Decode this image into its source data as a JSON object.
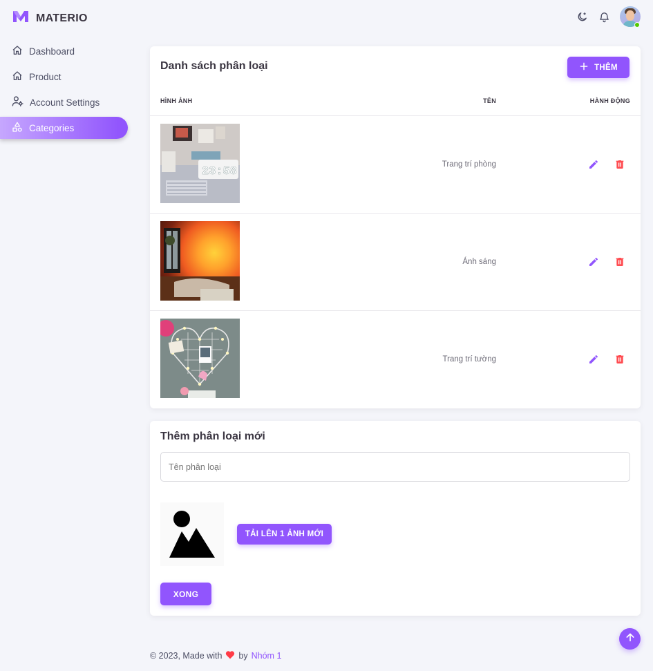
{
  "app": {
    "name": "MATERIO"
  },
  "nav": {
    "items": [
      {
        "label": "Dashboard",
        "icon": "home-icon"
      },
      {
        "label": "Product",
        "icon": "home-icon"
      },
      {
        "label": "Account Settings",
        "icon": "account-cog-icon"
      },
      {
        "label": "Categories",
        "icon": "shapes-icon",
        "active": true
      }
    ]
  },
  "list": {
    "title": "Danh sách phân loại",
    "add_label": "THÊM",
    "columns": {
      "image": "HÌNH ẢNH",
      "name": "TÊN",
      "actions": "HÀNH ĐỘNG"
    },
    "rows": [
      {
        "name": "Trang trí phòng",
        "image": "desk-clock-photo"
      },
      {
        "name": "Ánh sáng",
        "image": "sunset-lamp-photo"
      },
      {
        "name": "Trang trí tường",
        "image": "heart-wall-grid-photo"
      }
    ]
  },
  "form": {
    "title": "Thêm phân loại mới",
    "name_placeholder": "Tên phân loại",
    "upload_label": "TẢI LÊN 1 ẢNH MỚI",
    "done_label": "XONG"
  },
  "footer": {
    "prefix": "© 2023, Made with",
    "by": "by",
    "author": "Nhóm 1"
  },
  "colors": {
    "primary": "#9155fd",
    "danger": "#ff4c51",
    "background": "#f4f5fa",
    "online": "#56ca00"
  }
}
